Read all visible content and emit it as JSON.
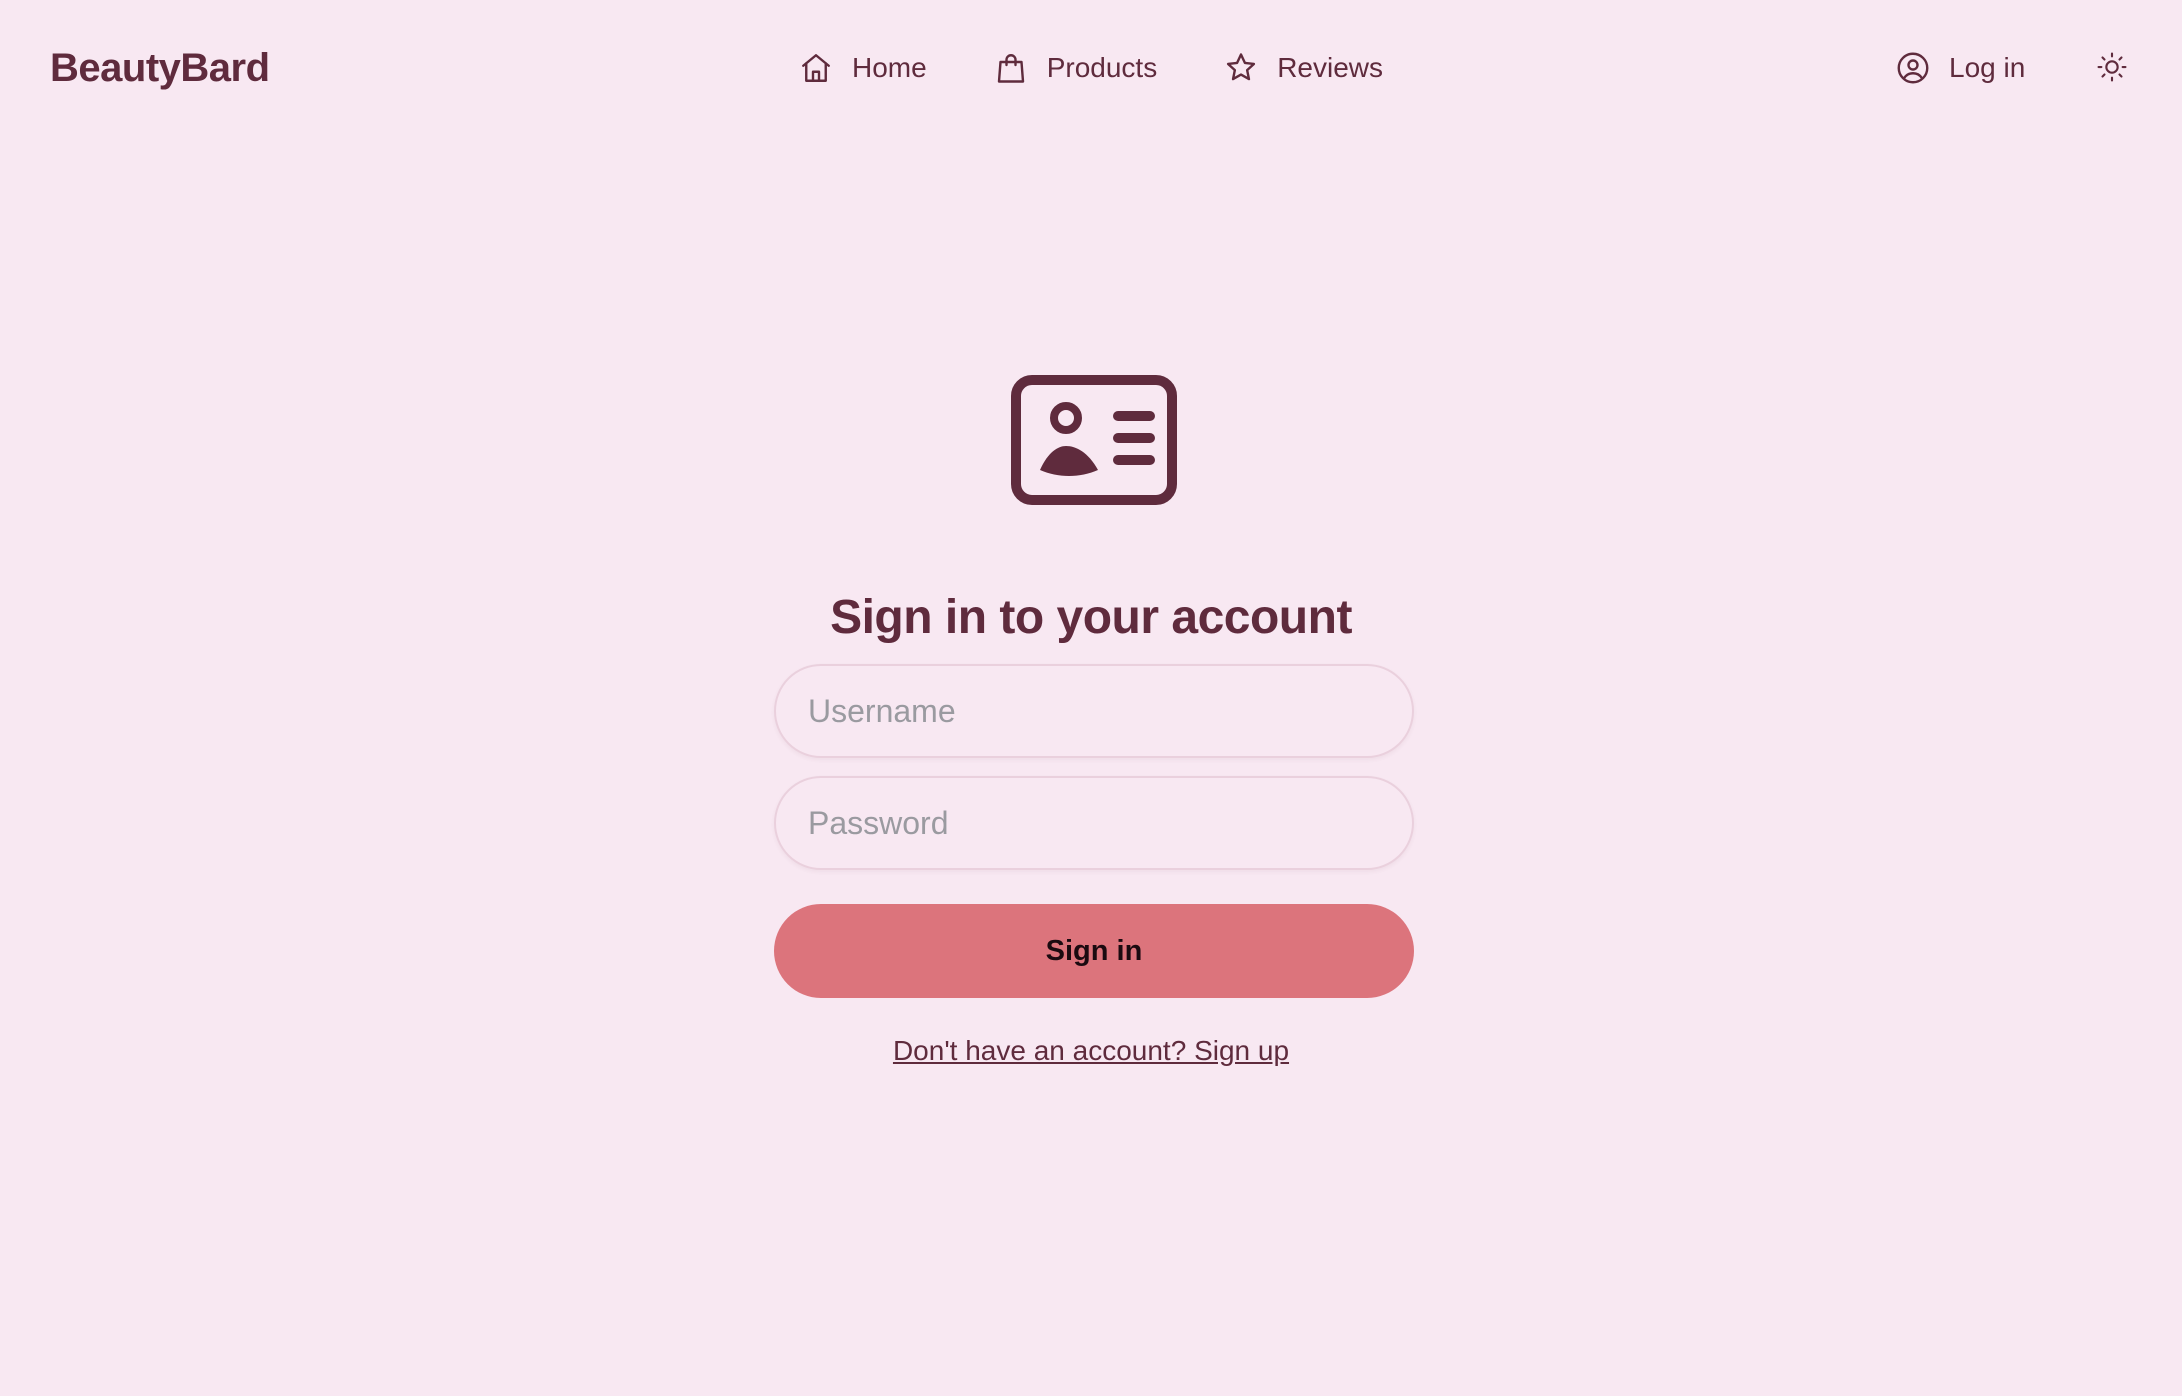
{
  "brand": "BeautyBard",
  "nav": {
    "items": [
      {
        "label": "Home",
        "icon": "home-icon"
      },
      {
        "label": "Products",
        "icon": "shopping-bag-icon"
      },
      {
        "label": "Reviews",
        "icon": "star-icon"
      }
    ],
    "login_label": "Log in",
    "login_icon": "user-circle-icon",
    "theme_icon": "sun-icon"
  },
  "main": {
    "icon": "id-card-icon",
    "title": "Sign in to your account",
    "username_placeholder": "Username",
    "password_placeholder": "Password",
    "submit_label": "Sign in",
    "signup_link": "Don't have an account? Sign up"
  },
  "colors": {
    "background": "#f8e8f2",
    "text": "#5f2b3d",
    "button": "#dc747c",
    "button_text": "#1b0a10",
    "placeholder": "#9a9aa0"
  }
}
